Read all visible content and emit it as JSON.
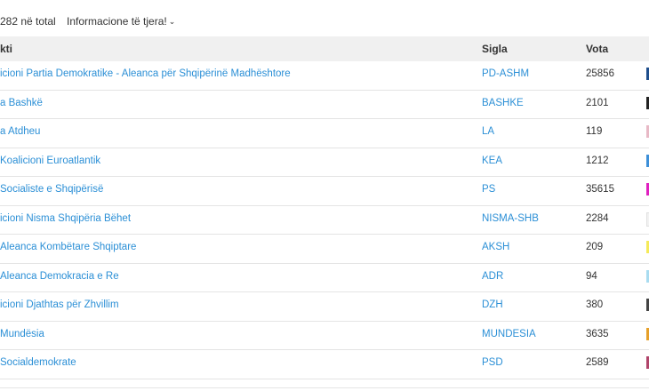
{
  "summary": {
    "total_text": "282 në total",
    "more_info_label": "Informacione të tjera!"
  },
  "table": {
    "headers": {
      "party": "kti",
      "abbr": "Sigla",
      "votes": "Vota"
    },
    "rows": [
      {
        "name": "icioni Partia Demokratike - Aleanca për Shqipërinë Madhështore",
        "abbr": "PD-ASHM",
        "votes": "25856",
        "color": "#1f4e8c"
      },
      {
        "name": "a Bashkë",
        "abbr": "BASHKE",
        "votes": "2101",
        "color": "#222222"
      },
      {
        "name": "a Atdheu",
        "abbr": "LA",
        "votes": "119",
        "color": "#e8b9c6"
      },
      {
        "name": "Koalicioni Euroatlantik",
        "abbr": "KEA",
        "votes": "1212",
        "color": "#3d8fd8"
      },
      {
        "name": "Socialiste e Shqipërisë",
        "abbr": "PS",
        "votes": "35615",
        "color": "#e020c0"
      },
      {
        "name": "icioni Nisma Shqipëria Bëhet",
        "abbr": "NISMA-SHB",
        "votes": "2284",
        "color": "#f2f2f2"
      },
      {
        "name": "Aleanca Kombëtare Shqiptare",
        "abbr": "AKSH",
        "votes": "209",
        "color": "#f5ea5a"
      },
      {
        "name": "Aleanca Demokracia e Re",
        "abbr": "ADR",
        "votes": "94",
        "color": "#a9dcf0"
      },
      {
        "name": "icioni Djathtas për Zhvillim",
        "abbr": "DZH",
        "votes": "380",
        "color": "#444444"
      },
      {
        "name": "Mundësia",
        "abbr": "MUNDESIA",
        "votes": "3635",
        "color": "#e6a02a"
      },
      {
        "name": "Socialdemokrate",
        "abbr": "PSD",
        "votes": "2589",
        "color": "#b0446a"
      }
    ]
  }
}
